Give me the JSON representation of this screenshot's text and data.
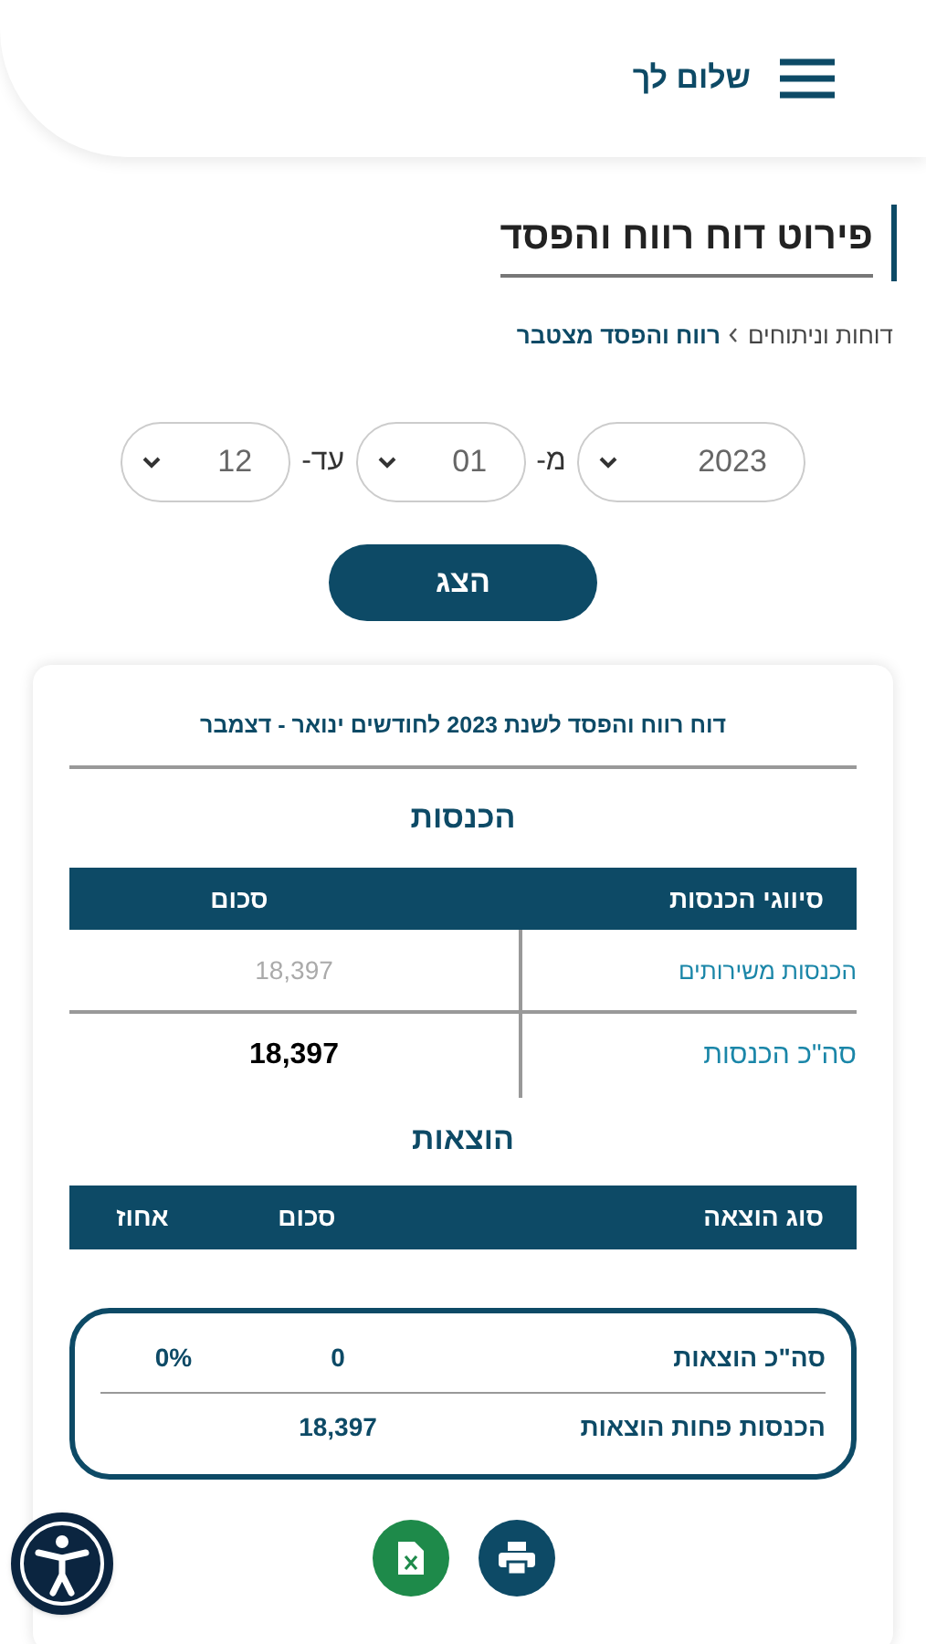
{
  "header": {
    "greeting": "שלום לך"
  },
  "page_title": "פירוט דוח רווח והפסד",
  "breadcrumb": [
    {
      "label": "דוחות וניתוחים",
      "current": false
    },
    {
      "label": "רווח והפסד מצטבר",
      "current": true
    }
  ],
  "filters": [
    {
      "kind": "select",
      "value": "2023"
    },
    {
      "kind": "label",
      "text": "מ-"
    },
    {
      "kind": "select",
      "value": "01"
    },
    {
      "kind": "label",
      "text": "עד-"
    },
    {
      "kind": "select",
      "value": "12"
    }
  ],
  "show_button": "הצג",
  "report": {
    "title": "דוח רווח והפסד לשנת 2023 לחודשים ינואר - דצמבר",
    "income": {
      "heading": "הכנסות",
      "columns": [
        "סיווגי הכנסות",
        "סכום"
      ],
      "rows": [
        {
          "kind": "item",
          "label": "הכנסות משירותים",
          "amount": "18,397"
        },
        {
          "kind": "total",
          "label": "סה\"כ הכנסות",
          "amount": "18,397"
        }
      ]
    },
    "expenses": {
      "heading": "הוצאות",
      "columns": [
        "סוג הוצאה",
        "סכום",
        "אחוז"
      ]
    },
    "summary": [
      {
        "label": "סה\"כ הוצאות",
        "amount": "0",
        "percent": "0%"
      },
      {
        "label": "הכנסות פחות הוצאות",
        "amount": "18,397"
      }
    ]
  }
}
